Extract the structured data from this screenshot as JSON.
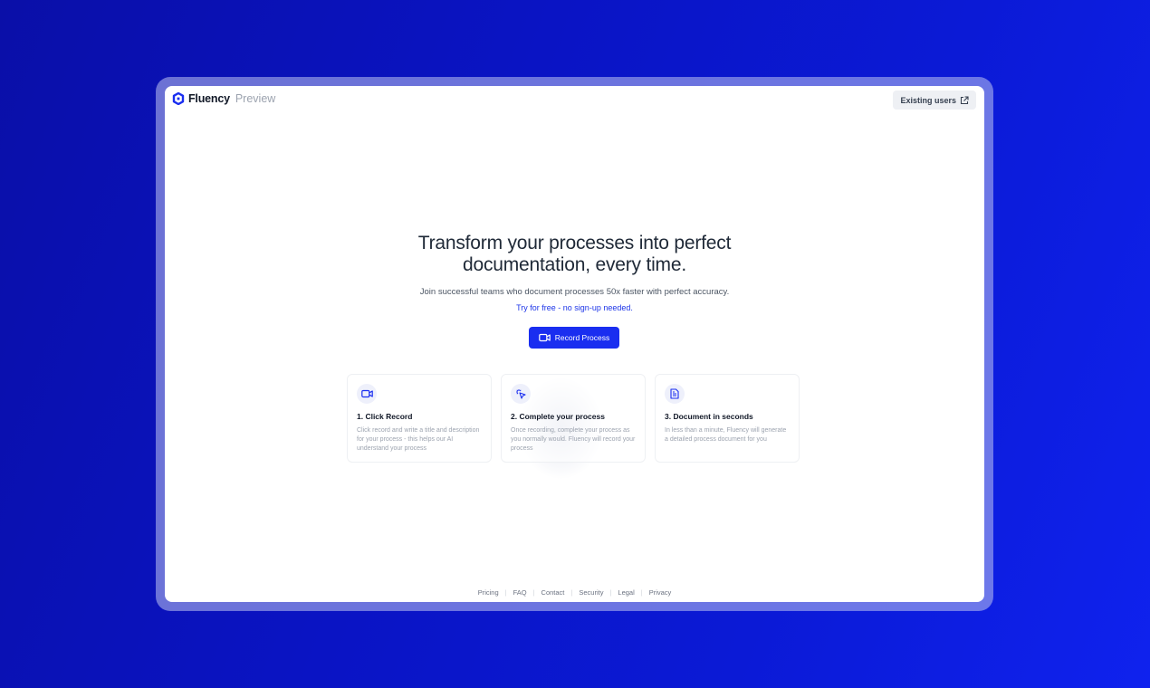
{
  "app": {
    "name": "Fluency",
    "tag": "Preview"
  },
  "header": {
    "existing_users_label": "Existing users"
  },
  "hero": {
    "headline_line1": "Transform your processes into perfect",
    "headline_line2": "documentation, every time.",
    "subline": "Join successful teams who document processes 50x faster with perfect accuracy.",
    "try_link": "Try for free - no sign-up needed.",
    "record_button": "Record Process"
  },
  "steps": [
    {
      "icon": "video-camera-icon",
      "title": "1. Click Record",
      "desc": "Click record and write a title and description for your process - this helps our AI understand your process"
    },
    {
      "icon": "cursor-click-icon",
      "title": "2. Complete your process",
      "desc": "Once recording, complete your process as you normally would. Fluency will record your process"
    },
    {
      "icon": "document-icon",
      "title": "3. Document in seconds",
      "desc": "In less than a minute, Fluency will generate a detailed process document for you"
    }
  ],
  "footer": {
    "links": [
      "Pricing",
      "FAQ",
      "Contact",
      "Security",
      "Legal",
      "Privacy"
    ]
  },
  "colors": {
    "accent": "#1a2ef0",
    "background": "#0a14c4"
  }
}
